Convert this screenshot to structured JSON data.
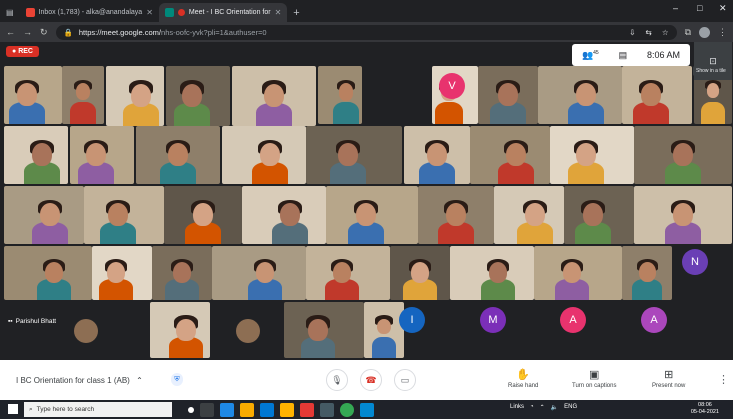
{
  "browser": {
    "tabs": [
      {
        "label": "Inbox (1,783) - alka@anandalaya",
        "favicon_color": "#ea4335"
      },
      {
        "label": "Meet - I BC Orientation for",
        "favicon_color": "#00897b"
      }
    ],
    "new_tab": "+",
    "url_host": "https://meet.google.com/",
    "url_path": "nhs-oofc-yvk?pli=1&authuser=0",
    "window_controls": [
      "–",
      "□",
      "✕"
    ]
  },
  "meet": {
    "rec_label": "REC",
    "time": "8:06 AM",
    "people_count": "45",
    "tooltip": "Show in a tile",
    "name_label": "Parishul Bhatt",
    "avatars": [
      {
        "letter": "V",
        "color": "#e8336e"
      },
      {
        "letter": "N",
        "color": "#6a3fb5"
      },
      {
        "letter": "I",
        "color": "#1565c0"
      },
      {
        "letter": "M",
        "color": "#7b2fb8"
      },
      {
        "letter": "A",
        "color": "#e8336e"
      },
      {
        "letter": "A",
        "color": "#ab47bc"
      }
    ]
  },
  "bottom": {
    "meeting_title": "I BC Orientation for class 1 (AB)",
    "raise_hand": "Raise hand",
    "captions": "Turn on captions",
    "present": "Present now"
  },
  "taskbar": {
    "search_placeholder": "Type here to search",
    "tray_label": "Links",
    "lang": "ENG",
    "clock_time": "08:06",
    "clock_date": "05-04-2021"
  }
}
